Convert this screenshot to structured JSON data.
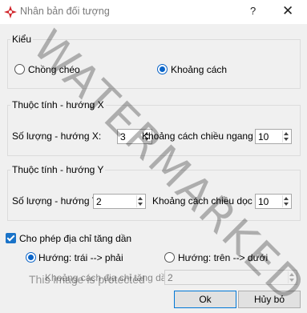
{
  "window": {
    "title": "Nhân bản đối tượng",
    "help": "?",
    "close": "✕"
  },
  "kind_group": {
    "title": "Kiểu",
    "option_overlap": "Chồng chéo",
    "option_spacing": "Khoảng cách",
    "selected": "Khoảng cách"
  },
  "group_x": {
    "title": "Thuộc tính - hướng X",
    "count_label": "Số lượng - hướng X:",
    "count_value": "3",
    "spacing_label": "Khoảng cách chiều ngang X:",
    "spacing_value": "10"
  },
  "group_y": {
    "title": "Thuộc tính - hướng Y",
    "count_label": "Số lượng - hướng Y:",
    "count_value": "2",
    "spacing_label": "Khoảng cách chiều dọc Y:",
    "spacing_value": "10"
  },
  "increment": {
    "checkbox_label": "Cho phép địa chỉ tăng dần",
    "checked": true,
    "dir_left_right": "Hướng: trái --> phải",
    "dir_top_bottom": "Hướng: trên --> dưới",
    "selected": "Hướng: trái --> phải",
    "step_label": "Khoảng cách địa chỉ tăng dần:",
    "step_value": "2"
  },
  "buttons": {
    "ok": "Ok",
    "cancel": "Hủy bỏ"
  },
  "overlay": {
    "watermark": "WATERMARKED",
    "protected": "This image is protected"
  }
}
